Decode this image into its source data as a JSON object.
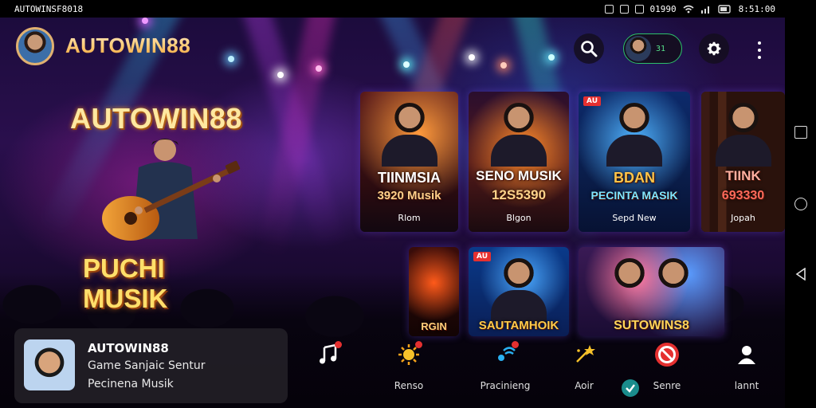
{
  "status_bar": {
    "left_text": "AUTOWINSF8018",
    "network_text": "01990",
    "time_text": "8:51:00"
  },
  "header": {
    "brand": "AUTOWIN88",
    "user_chip_text": "31"
  },
  "hero": {
    "title": "AUTOWIN88",
    "subtitle": "PUCHI MUSIK"
  },
  "cards_row1": [
    {
      "title": "TIINMSIA",
      "subtitle": "3920 Musik",
      "footer": "Rlom",
      "accent": "#e0661c"
    },
    {
      "title": "SENO MUSIK",
      "subtitle": "12S5390",
      "footer": "Blgon",
      "accent": "#d64b12"
    },
    {
      "title": "BDAN",
      "subtitle": "PECINTA MASIK",
      "footer": "Sepd New",
      "accent": "#1c6fd6",
      "badge": "AU"
    },
    {
      "title": "TIINK",
      "subtitle": "693330",
      "footer": "Jopah",
      "accent": "#6b3a24"
    }
  ],
  "cards_row2": [
    {
      "title": "RGIN",
      "accent": "#a01a0c"
    },
    {
      "title": "SAUTAMHOIK",
      "accent": "#0d4fb5",
      "badge": "AU"
    },
    {
      "title": "SUTOWINS8",
      "accent": "#1d7ad0"
    }
  ],
  "bottom_panel": {
    "title": "AUTOWIN88",
    "line1": "Game Sanjaic Sentur",
    "line2": "Pecinena Musik"
  },
  "tabs": [
    {
      "label": "",
      "icon": "music-note-icon"
    },
    {
      "label": "Renso",
      "icon": "sun-icon"
    },
    {
      "label": "Pracinieng",
      "icon": "broadcast-icon"
    },
    {
      "label": "Aoir",
      "icon": "star-wand-icon"
    },
    {
      "label": "Senre",
      "icon": "no-entry-icon"
    },
    {
      "label": "lannt",
      "icon": "person-icon"
    }
  ],
  "colors": {
    "brand_gold": "#f5b540",
    "accent_green": "#2cc06a",
    "badge_red": "#e53030"
  }
}
